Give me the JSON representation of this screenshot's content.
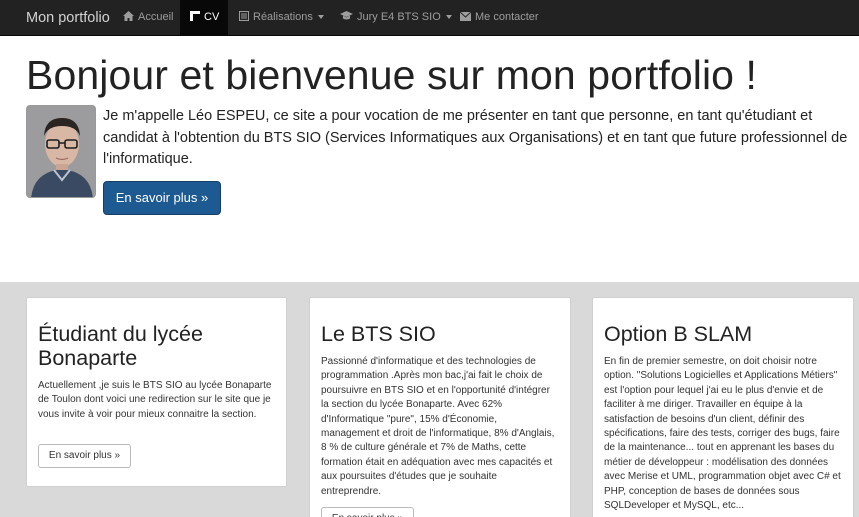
{
  "navbar": {
    "brand": "Mon portfolio",
    "items": [
      {
        "label": "Accueil",
        "icon": "home-icon"
      },
      {
        "label": "CV",
        "icon": "cv-icon",
        "active": true
      },
      {
        "label": "Réalisations",
        "icon": "list-icon",
        "dropdown": true
      },
      {
        "label": "Jury E4 BTS SIO",
        "icon": "graduation-cap-icon",
        "dropdown": true
      },
      {
        "label": "Me contacter",
        "icon": "envelope-icon"
      }
    ]
  },
  "hero": {
    "title": "Bonjour et bienvenue sur mon portfolio !",
    "text": "Je m'appelle Léo ESPEU, ce site a pour vocation de me présenter en tant que personne, en tant qu'étudiant et candidat à l'obtention du BTS SIO (Services Informatiques aux Organisations) et en tant que future professionnel de l'informatique.",
    "button": "En savoir plus »"
  },
  "cards": [
    {
      "title": "Étudiant du lycée Bonaparte",
      "text": "Actuellement ,je suis le BTS SIO au lycée Bonaparte de Toulon dont voici une redirection sur le site que je vous invite à voir pour mieux connaitre la section.",
      "button": "En savoir plus »"
    },
    {
      "title": "Le BTS SIO",
      "text": "Passionné d'informatique et des technologies de programmation .Après mon bac,j'ai fait le choix de poursuivre en BTS SIO et en l'opportunité d'intégrer la section du lycée Bonaparte. Avec 62% d'Informatique \"pure\", 15% d'Économie, management et droit de l'informatique, 8% d'Anglais, 8 % de culture générale et 7% de Maths, cette formation était en adéquation avec mes capacités et aux poursuites d'études que je souhaite entreprendre.",
      "button": "En savoir plus »"
    },
    {
      "title": "Option B SLAM",
      "text": "En fin de premier semestre, on doit choisir notre option. \"Solutions Logicielles et Applications Métiers\" est l'option pour lequel j'ai eu le plus d'envie et de faciliter à me diriger. Travailler en équipe à la satisfaction de besoins d'un client, définir des spécifications, faire des tests, corriger des bugs, faire de la maintenance... tout en apprenant les bases du métier de développeur : modélisation des données avec Merise et UML, programmation objet avec C# et PHP, conception de bases de données sous SQLDeveloper et MySQL, etc..."
    }
  ],
  "colors": {
    "navbar_bg": "#222222",
    "primary_button": "#1d5a91",
    "lower_bg": "#d9d9d9"
  }
}
